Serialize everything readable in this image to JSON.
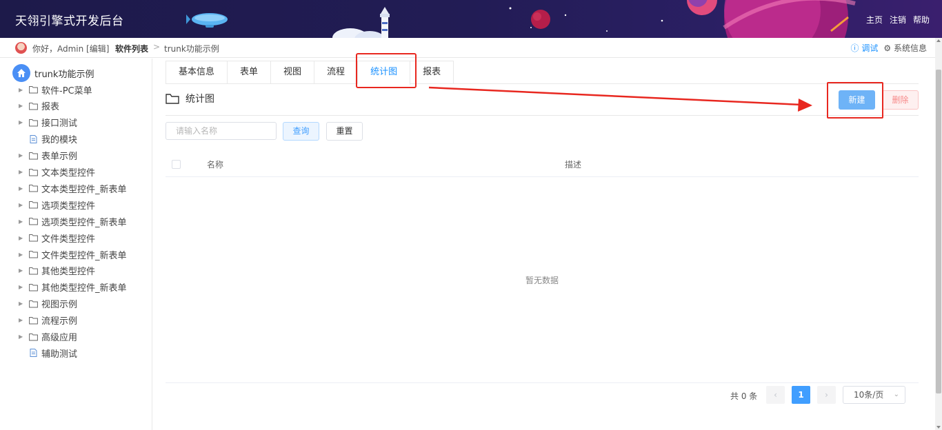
{
  "header": {
    "title": "天翎引擎式开发后台",
    "links": [
      "主页",
      "注销",
      "帮助"
    ]
  },
  "crumbbar": {
    "greeting": "你好，Admin [编辑]",
    "software_list": "软件列表",
    "separator": ">",
    "current": "trunk功能示例",
    "debug": "调试",
    "system_info": "系统信息"
  },
  "sidebar": {
    "root": "trunk功能示例",
    "items": [
      {
        "label": "软件-PC菜单",
        "type": "folder"
      },
      {
        "label": "报表",
        "type": "folder"
      },
      {
        "label": "接口测试",
        "type": "folder"
      },
      {
        "label": "我的模块",
        "type": "file"
      },
      {
        "label": "表单示例",
        "type": "folder"
      },
      {
        "label": "文本类型控件",
        "type": "folder"
      },
      {
        "label": "文本类型控件_新表单",
        "type": "folder"
      },
      {
        "label": "选项类型控件",
        "type": "folder"
      },
      {
        "label": "选项类型控件_新表单",
        "type": "folder"
      },
      {
        "label": "文件类型控件",
        "type": "folder"
      },
      {
        "label": "文件类型控件_新表单",
        "type": "folder"
      },
      {
        "label": "其他类型控件",
        "type": "folder"
      },
      {
        "label": "其他类型控件_新表单",
        "type": "folder"
      },
      {
        "label": "视图示例",
        "type": "folder"
      },
      {
        "label": "流程示例",
        "type": "folder"
      },
      {
        "label": "高级应用",
        "type": "folder"
      },
      {
        "label": "辅助测试",
        "type": "file"
      }
    ]
  },
  "tabs": [
    {
      "label": "基本信息"
    },
    {
      "label": "表单"
    },
    {
      "label": "视图"
    },
    {
      "label": "流程"
    },
    {
      "label": "统计图",
      "active": true
    },
    {
      "label": "报表"
    }
  ],
  "section": {
    "title": "统计图",
    "new_label": "新建",
    "delete_label": "删除"
  },
  "search": {
    "placeholder": "请输入名称",
    "query_label": "查询",
    "reset_label": "重置"
  },
  "table": {
    "columns": [
      "名称",
      "描述"
    ],
    "empty_text": "暂无数据"
  },
  "pagination": {
    "total": "共 0 条",
    "current_page": "1",
    "page_size": "10条/页"
  },
  "colors": {
    "accent": "#409eff",
    "annotation_red": "#e8271f",
    "header_bg": "#221c55"
  }
}
